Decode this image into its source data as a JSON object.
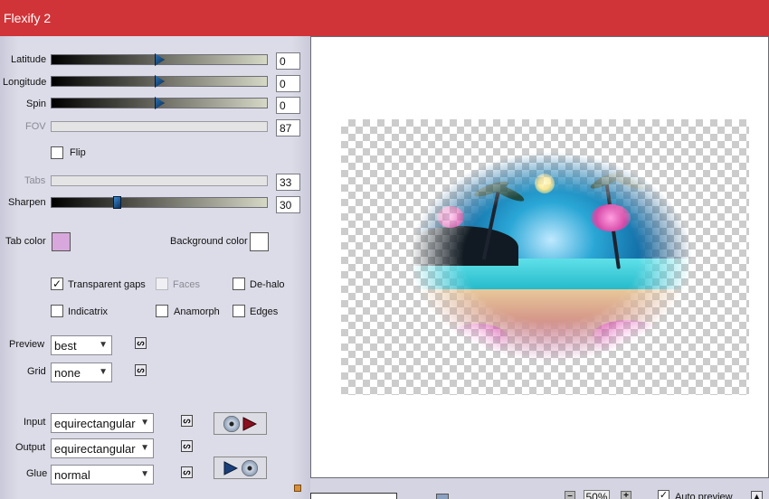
{
  "window": {
    "title": "Flexify 2",
    "title_bar_color": "#d13438"
  },
  "sliders": [
    {
      "label": "Latitude",
      "value": "0",
      "position": 0.5,
      "enabled": true
    },
    {
      "label": "Longitude",
      "value": "0",
      "position": 0.5,
      "enabled": true
    },
    {
      "label": "Spin",
      "value": "0",
      "position": 0.5,
      "enabled": true
    },
    {
      "label": "FOV",
      "value": "87",
      "enabled": false
    },
    {
      "label": "Tabs",
      "value": "33",
      "enabled": false
    },
    {
      "label": "Sharpen",
      "value": "30",
      "position": 0.3,
      "enabled": true
    }
  ],
  "flip": {
    "label": "Flip",
    "checked": false
  },
  "colors": {
    "tab_color_label": "Tab color",
    "tab_color": "#d8a8dc",
    "background_color_label": "Background color",
    "background_color": "#ffffff"
  },
  "options": {
    "transparent_gaps": {
      "label": "Transparent gaps",
      "checked": true,
      "mark": "✓"
    },
    "faces": {
      "label": "Faces",
      "checked": false,
      "enabled": false
    },
    "de_halo": {
      "label": "De-halo",
      "checked": false
    },
    "indicatrix": {
      "label": "Indicatrix",
      "checked": false
    },
    "anamorph": {
      "label": "Anamorph",
      "checked": false
    },
    "edges": {
      "label": "Edges",
      "checked": false
    }
  },
  "preview_select": {
    "label": "Preview",
    "value": "best"
  },
  "grid_select": {
    "label": "Grid",
    "value": "none"
  },
  "input_select": {
    "label": "Input",
    "value": "equirectangular"
  },
  "output_select": {
    "label": "Output",
    "value": "equirectangular"
  },
  "glue_select": {
    "label": "Glue",
    "value": "normal"
  },
  "link_glyph": "ᔕ",
  "arrow_glyph": "▼",
  "zoom": {
    "value": "50%",
    "minus": "–",
    "plus": "+"
  },
  "auto_preview": {
    "label": "Auto preview",
    "checked": true,
    "mark": "✓"
  }
}
